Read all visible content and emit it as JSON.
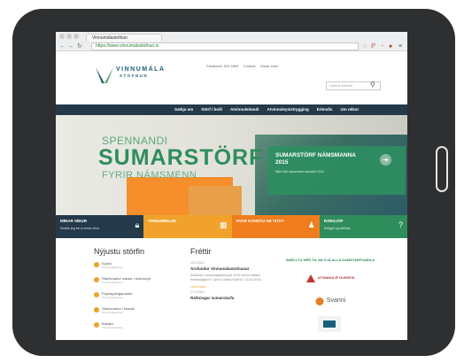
{
  "browser": {
    "tab_title": "Vinnumálastofnun",
    "url": "https://www.vinnumalastofnun.is"
  },
  "site": {
    "logo_line1": "VINNUMÁLA",
    "logo_line2": "STOFNUN",
    "top_links": [
      "Símaborð: 515 4800",
      "Innskrá",
      "Mínar síður"
    ],
    "search_placeholder": "Leita á vefnum",
    "menu": [
      "Sækja um",
      "Störf í boði",
      "Atvinnuleitandi",
      "Atvinnuleysistrygging",
      "Erlendis",
      "Um okkur"
    ]
  },
  "hero": {
    "line1": "SPENNANDI",
    "line2": "SUMARSTÖRF",
    "line3": "FYRIR NÁMSMENN",
    "box_title": "SUMARSTÖRF NÁMSMANNA 2015",
    "box_text": "Störf fyrir námsmenn sumarið 2015"
  },
  "tiles": [
    {
      "title": "MÍNAR SÍÐUR",
      "sub": "Skráðu þig inn á mínar síður",
      "color": "#24394a",
      "icon": "lock-icon"
    },
    {
      "title": "VINNUMIÐLUN",
      "sub": "",
      "color": "#f0a22c",
      "icon": "calendar-icon"
    },
    {
      "title": "HVAR KANNTU AÐ VITA?",
      "sub": "",
      "color": "#ef7d1e",
      "icon": "person-icon"
    },
    {
      "title": "RÁÐGJÖF",
      "sub": "Ráðgjöf og fræðsla",
      "color": "#2f8d5c",
      "icon": "help-icon"
    }
  ],
  "jobs": {
    "heading": "Nýjustu störfin",
    "items": [
      {
        "title": "Kjúpsi",
        "sub": "Vinnumálastofnun"
      },
      {
        "title": "Starfsmaður óskast í mötuneyti",
        "sub": "Vinnumálastofnun"
      },
      {
        "title": "Pípulagningamaður",
        "sub": "Vinnumálastofnun"
      },
      {
        "title": "Starfsmaður í bakaríi",
        "sub": "Vinnumálastofnun"
      },
      {
        "title": "Bílstjóri",
        "sub": "Vinnumálastofnun"
      }
    ]
  },
  "news": {
    "heading": "Fréttir",
    "items": [
      {
        "date": "18.3.2015",
        "title": "Ársfundur Vinnumálastofnunar",
        "body": "Ársfundur Vinnumálastofnunar 2015 verður haldinn fimmtudaginn 9. apríl á Grand Hótel kl. 13:00-15:00.",
        "more": "Lesa meira"
      },
      {
        "date": "17.3.2015",
        "title": "Ráðningar sumarstarfa",
        "body": "",
        "more": ""
      }
    ]
  },
  "partners": {
    "heading": "SMELLTU HÉR TIL AÐ SJÁ ALLA SAMSTARFSAÐILA",
    "items": [
      {
        "name": "ATVINNULÍF HVERFIS"
      },
      {
        "name": "Svanni"
      },
      {
        "name": ""
      }
    ]
  }
}
